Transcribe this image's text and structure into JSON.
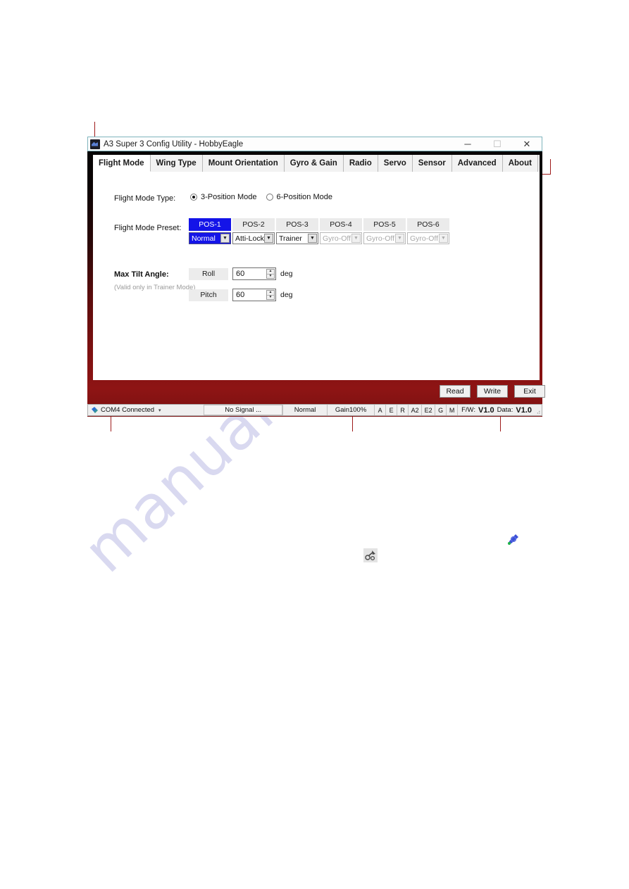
{
  "window": {
    "title": "A3 Super 3 Config Utility - HobbyEagle",
    "app_icon": "app-logo-icon",
    "controls": {
      "minimize": "─",
      "maximize": "☐",
      "close": "✕"
    }
  },
  "tabs": [
    {
      "label": "Flight Mode",
      "active": true
    },
    {
      "label": "Wing Type",
      "active": false
    },
    {
      "label": "Mount Orientation",
      "active": false
    },
    {
      "label": "Gyro & Gain",
      "active": false
    },
    {
      "label": "Radio",
      "active": false
    },
    {
      "label": "Servo",
      "active": false
    },
    {
      "label": "Sensor",
      "active": false
    },
    {
      "label": "Advanced",
      "active": false
    },
    {
      "label": "About",
      "active": false
    }
  ],
  "form": {
    "flight_mode_type_label": "Flight Mode Type:",
    "flight_mode_type_options": [
      {
        "label": "3-Position Mode",
        "checked": true
      },
      {
        "label": "6-Position Mode",
        "checked": false
      }
    ],
    "flight_mode_preset_label": "Flight Mode Preset:",
    "presets": [
      {
        "position": "POS-1",
        "mode": "Normal",
        "selected": true,
        "disabled": false
      },
      {
        "position": "POS-2",
        "mode": "Atti-Lock",
        "selected": false,
        "disabled": false
      },
      {
        "position": "POS-3",
        "mode": "Trainer",
        "selected": false,
        "disabled": false
      },
      {
        "position": "POS-4",
        "mode": "Gyro-Off",
        "selected": false,
        "disabled": true
      },
      {
        "position": "POS-5",
        "mode": "Gyro-Off",
        "selected": false,
        "disabled": true
      },
      {
        "position": "POS-6",
        "mode": "Gyro-Off",
        "selected": false,
        "disabled": true
      }
    ],
    "max_tilt_label": "Max Tilt Angle:",
    "max_tilt_note": "(Valid only in Trainer Mode)",
    "tilt_rows": [
      {
        "axis": "Roll",
        "value": "60",
        "unit": "deg"
      },
      {
        "axis": "Pitch",
        "value": "60",
        "unit": "deg"
      }
    ]
  },
  "actions": [
    {
      "label": "Read"
    },
    {
      "label": "Write"
    },
    {
      "label": "Exit"
    }
  ],
  "status": {
    "connection": "COM4 Connected",
    "connection_icon": "connection-plug-icon",
    "caret": "▾",
    "signal": "No Signal ...",
    "mode": "Normal",
    "gain": "Gain100%",
    "channels": [
      "A",
      "E",
      "R",
      "A2",
      "E2",
      "G",
      "M"
    ],
    "fw_label": "F/W:",
    "fw_value": "V1.0",
    "data_label": "Data:",
    "data_value": "V1.0",
    "grip": "⠴"
  },
  "watermark": {
    "text": "manualslib.com",
    "logo_name": "manualslib-logo-icon"
  },
  "colors": {
    "accent_blue": "#1414e8",
    "frame_red": "#8e1414",
    "frame_black": "#050505",
    "annotation_red": "#9e1b1b",
    "watermark": "#d9d9f0"
  }
}
